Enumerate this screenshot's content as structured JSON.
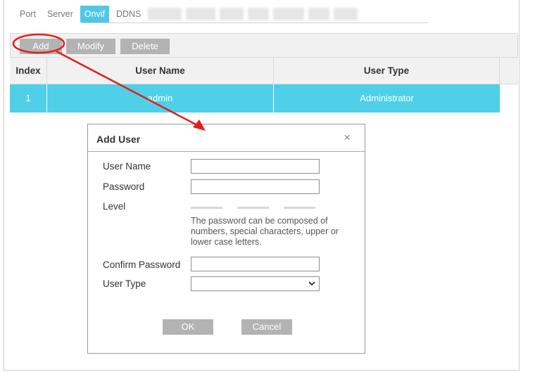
{
  "tabs": [
    "Port",
    "Server",
    "Onvif",
    "DDNS"
  ],
  "active_tab": "Onvif",
  "toolbar": {
    "add_label": "Add",
    "modify_label": "Modify",
    "delete_label": "Delete"
  },
  "table": {
    "headers": {
      "index": "Index",
      "user_name": "User Name",
      "user_type": "User Type"
    },
    "rows": [
      {
        "index": "1",
        "user_name": "admin",
        "user_type": "Administrator"
      }
    ]
  },
  "dialog": {
    "title": "Add User",
    "close_glyph": "×",
    "labels": {
      "user_name": "User Name",
      "password": "Password",
      "level": "Level",
      "confirm_password": "Confirm Password",
      "user_type": "User Type"
    },
    "values": {
      "user_name": "",
      "password": "",
      "confirm_password": "",
      "user_type": ""
    },
    "password_hint": "The password can be composed of numbers, special characters, upper or lower case letters.",
    "ok_label": "OK",
    "cancel_label": "Cancel"
  },
  "colors": {
    "accent": "#4fc8e5",
    "selected_row": "#4fd0e8",
    "button_gray": "#b3b3b3",
    "annotation_red": "#e0201b"
  },
  "icons": {
    "close": "close-icon",
    "dropdown": "chevron-down-icon"
  }
}
